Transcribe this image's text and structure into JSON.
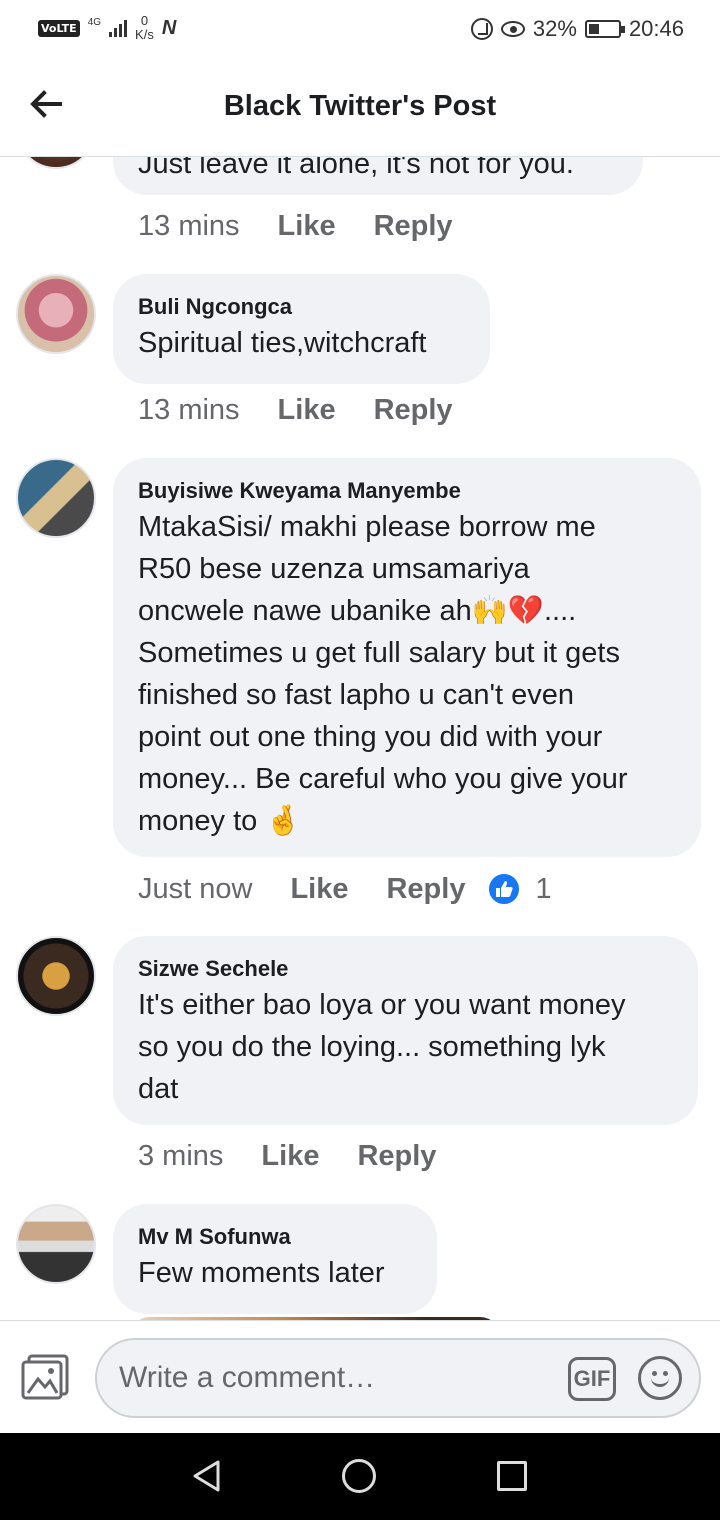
{
  "status_bar": {
    "volte": "VoLTE",
    "network": "4G",
    "speed_value": "0",
    "speed_unit": "K/s",
    "battery": "32%",
    "time": "20:46"
  },
  "header": {
    "title": "Black Twitter's Post"
  },
  "comments": [
    {
      "name": "",
      "text": "Just leave it alone, it's not for you.",
      "time": "13 mins",
      "like": "Like",
      "reply": "Reply"
    },
    {
      "name": "Buli Ngcongca",
      "text": "Spiritual ties,witchcraft",
      "time": "13 mins",
      "like": "Like",
      "reply": "Reply"
    },
    {
      "name": "Buyisiwe Kweyama Manyembe",
      "text_lines": [
        "MtakaSisi/ makhi please borrow me",
        "R50 bese uzenza umsamariya",
        "oncwele nawe ubanike ah🙌💔....",
        "Sometimes u get full salary but it gets",
        "finished so fast lapho u can't even",
        "point out one thing you did with your",
        "money... Be careful who you give your",
        "money to 🤞"
      ],
      "time": "Just now",
      "like": "Like",
      "reply": "Reply",
      "reaction_count": "1"
    },
    {
      "name": "Sizwe Sechele",
      "text_lines": [
        "It's either bao loya or you want money",
        "so you do the loying... something lyk",
        "dat"
      ],
      "time": "3 mins",
      "like": "Like",
      "reply": "Reply"
    },
    {
      "name": "Mv M Sofunwa",
      "text": "Few moments later"
    }
  ],
  "composer": {
    "placeholder": "Write a comment…",
    "gif_label": "GIF"
  },
  "icons": {
    "back": "arrow-left-icon",
    "photo": "photo-icon",
    "emoji": "smiley-icon",
    "like_reaction": "thumbs-up-icon"
  },
  "colors": {
    "accent": "#1877f2",
    "bubble": "#f0f2f5",
    "meta": "#65676b"
  }
}
